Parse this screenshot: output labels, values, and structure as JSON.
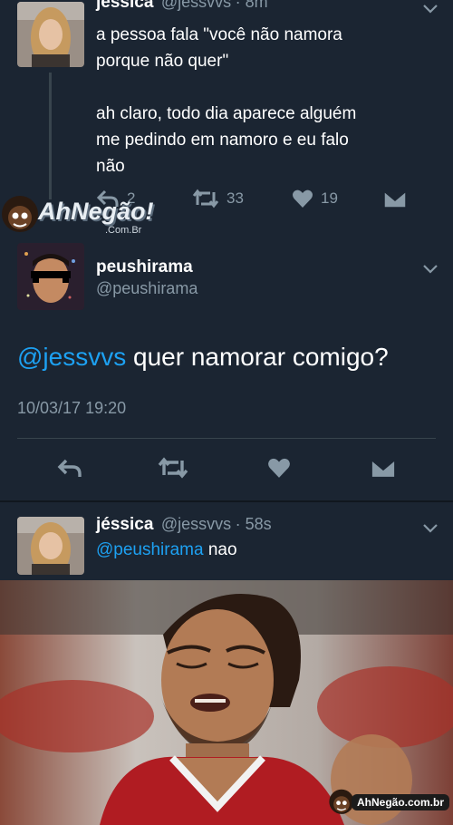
{
  "tweet1": {
    "name": "jessica",
    "handle": "@jessvvs",
    "time": "· 8m",
    "line1": "a pessoa fala \"você não namora",
    "line2": "porque não quer\"",
    "line3": "ah claro, todo dia aparece alguém",
    "line4": "me pedindo em namoro e eu falo",
    "line5": "não",
    "reply_count": "2",
    "retweet_count": "33",
    "like_count": "19"
  },
  "watermark": {
    "brand": "AhNegão!",
    "sub": ".Com.Br",
    "bottom": "AhNegão.com.br"
  },
  "tweet2": {
    "name": "peushirama",
    "handle": "@peushirama",
    "mention": "@jessvvs",
    "text": " quer namorar comigo?",
    "timestamp": "10/03/17 19:20"
  },
  "tweet3": {
    "name": "jéssica",
    "handle": "@jessvvs",
    "time": "· 58s",
    "mention": "@peushirama",
    "text": " nao"
  },
  "colors": {
    "background": "#1b2532",
    "text": "#ffffff",
    "muted": "#8899a6",
    "link": "#1da1f2"
  }
}
